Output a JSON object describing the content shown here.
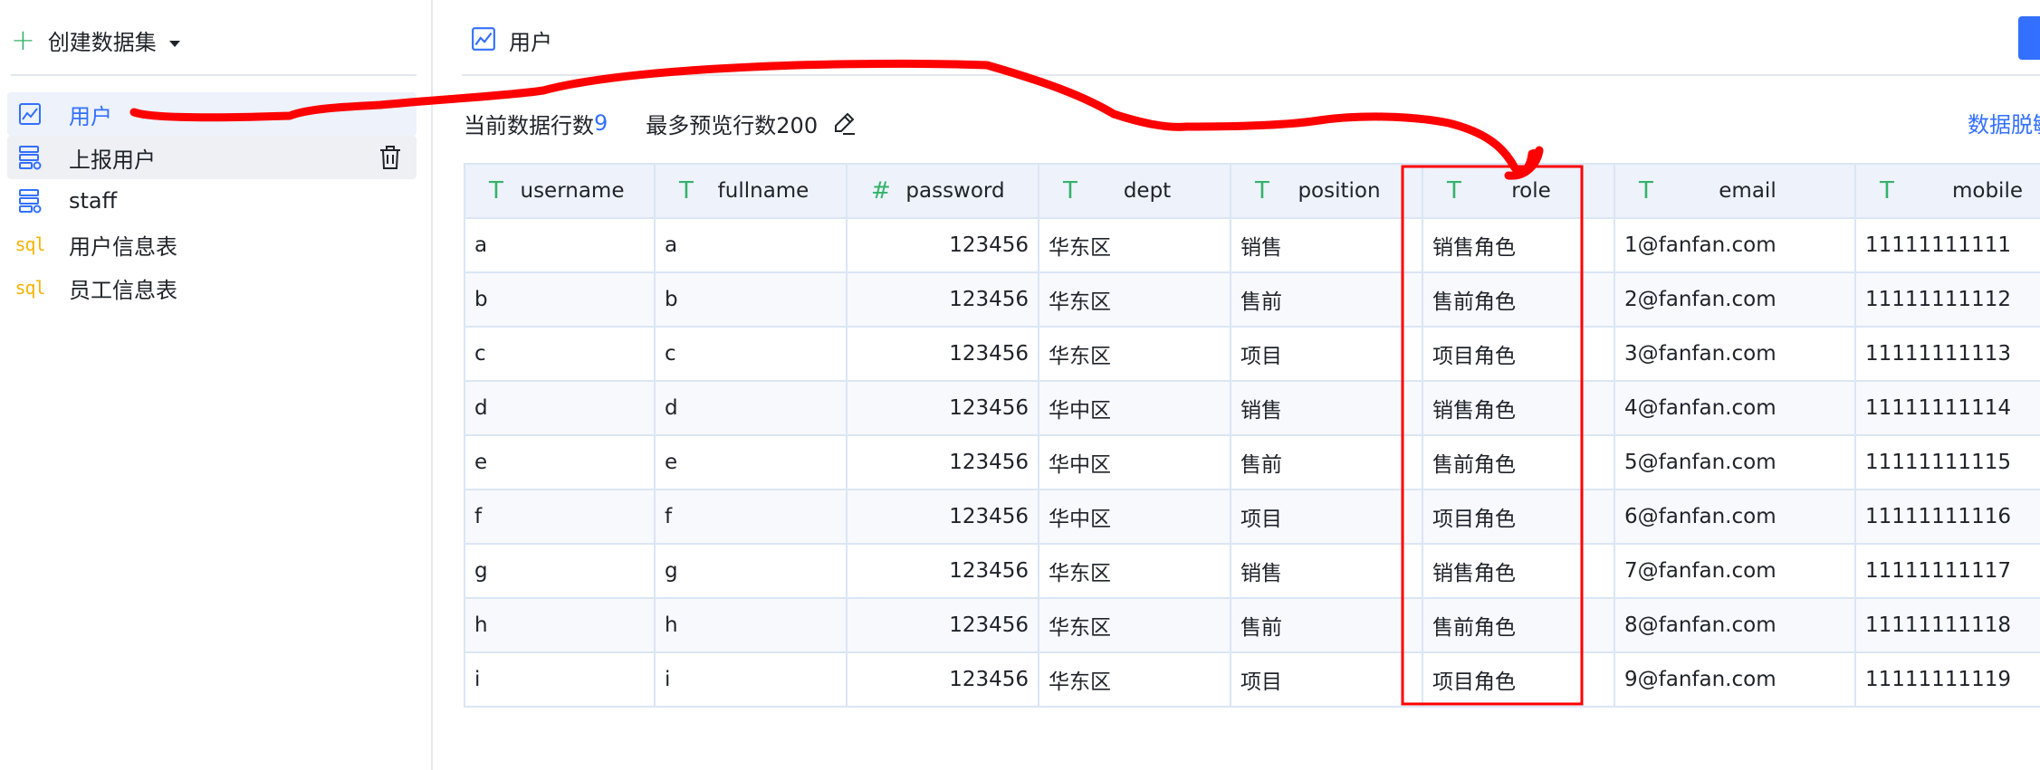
{
  "sidebar": {
    "create_label": "创建数据集",
    "items": [
      {
        "label": "用户",
        "icon": "chart-line-icon",
        "active": true
      },
      {
        "label": "上报用户",
        "icon": "db-table-icon"
      },
      {
        "label": "staff",
        "icon": "db-table-icon"
      },
      {
        "label": "用户信息表",
        "icon": "sql-icon",
        "icon_text": "sql"
      },
      {
        "label": "员工信息表",
        "icon": "sql-icon",
        "icon_text": "sql"
      }
    ]
  },
  "main": {
    "title": "用户",
    "stats": {
      "rows_label": "当前数据行数",
      "rows_value": "9",
      "preview_label": "最多预览行数200"
    },
    "mask_link": "数据脱敏"
  },
  "table": {
    "columns": [
      {
        "name": "username",
        "type_icon": "T"
      },
      {
        "name": "fullname",
        "type_icon": "T"
      },
      {
        "name": "password",
        "type_icon": "#"
      },
      {
        "name": "dept",
        "type_icon": "T"
      },
      {
        "name": "position",
        "type_icon": "T"
      },
      {
        "name": "role",
        "type_icon": "T"
      },
      {
        "name": "email",
        "type_icon": "T"
      },
      {
        "name": "mobile",
        "type_icon": "T"
      }
    ],
    "rows": [
      [
        "a",
        "a",
        "123456",
        "华东区",
        "销售",
        "销售角色",
        "1@fanfan.com",
        "11111111111"
      ],
      [
        "b",
        "b",
        "123456",
        "华东区",
        "售前",
        "售前角色",
        "2@fanfan.com",
        "11111111112"
      ],
      [
        "c",
        "c",
        "123456",
        "华东区",
        "项目",
        "项目角色",
        "3@fanfan.com",
        "11111111113"
      ],
      [
        "d",
        "d",
        "123456",
        "华中区",
        "销售",
        "销售角色",
        "4@fanfan.com",
        "11111111114"
      ],
      [
        "e",
        "e",
        "123456",
        "华中区",
        "售前",
        "售前角色",
        "5@fanfan.com",
        "11111111115"
      ],
      [
        "f",
        "f",
        "123456",
        "华中区",
        "项目",
        "项目角色",
        "6@fanfan.com",
        "11111111116"
      ],
      [
        "g",
        "g",
        "123456",
        "华东区",
        "销售",
        "销售角色",
        "7@fanfan.com",
        "11111111117"
      ],
      [
        "h",
        "h",
        "123456",
        "华东区",
        "售前",
        "售前角色",
        "8@fanfan.com",
        "11111111118"
      ],
      [
        "i",
        "i",
        "123456",
        "华东区",
        "项目",
        "项目角色",
        "9@fanfan.com",
        "11111111119"
      ]
    ]
  },
  "annotation": {
    "stroke_color": "#ff0000",
    "highlight_column": "role"
  },
  "colors": {
    "accent": "#3370ff",
    "type_icon": "#34b26a",
    "sql_icon": "#f5b400"
  }
}
